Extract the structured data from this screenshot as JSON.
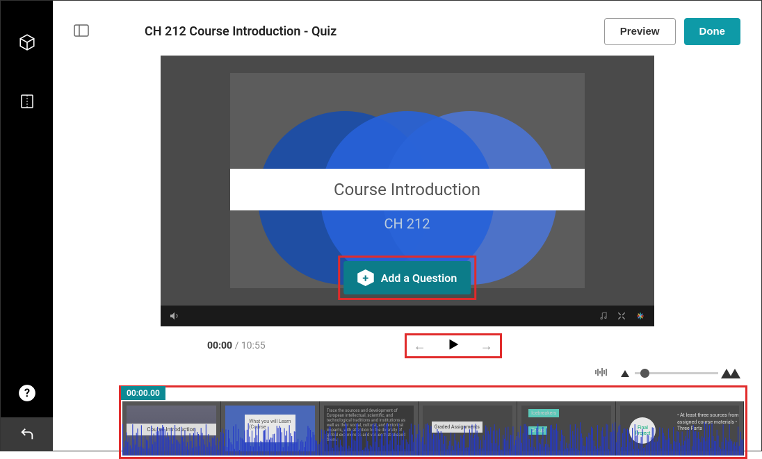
{
  "header": {
    "title": "CH 212 Course Introduction - Quiz",
    "preview": "Preview",
    "done": "Done"
  },
  "slide": {
    "title": "Course Introduction",
    "subtitle": "CH 212"
  },
  "add_question": "Add a Question",
  "playback": {
    "current": "00:00",
    "total": "10:55"
  },
  "timeline": {
    "badge": "00:00.00",
    "thumbs": {
      "t1": "Course Introduction",
      "t2": "What you will Learn (Course",
      "t3": "Trace the sources and development of European intellectual, scientific, and technological traditions and institutions as well as their social, cultural, and historical impacts, with attention to the diversity of global experiences and values that shaped them.",
      "t4": "Graded Assignments",
      "t5a": "Icebreakers",
      "t5b": "Group",
      "t6a": "Final Project",
      "t6b": "• At least three sources from assigned course materials\n• Three Parts"
    }
  }
}
